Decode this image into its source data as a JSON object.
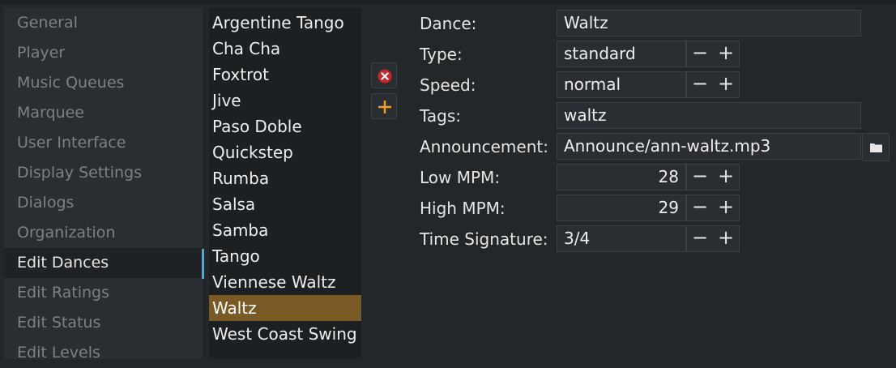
{
  "settings_nav": {
    "items": [
      {
        "label": "General"
      },
      {
        "label": "Player"
      },
      {
        "label": "Music Queues"
      },
      {
        "label": "Marquee"
      },
      {
        "label": "User Interface"
      },
      {
        "label": "Display Settings"
      },
      {
        "label": "Dialogs"
      },
      {
        "label": "Organization"
      },
      {
        "label": "Edit Dances",
        "selected": true
      },
      {
        "label": "Edit Ratings"
      },
      {
        "label": "Edit Status"
      },
      {
        "label": "Edit Levels"
      }
    ]
  },
  "dance_list": {
    "items": [
      {
        "label": "Argentine Tango"
      },
      {
        "label": "Cha Cha"
      },
      {
        "label": "Foxtrot"
      },
      {
        "label": "Jive"
      },
      {
        "label": "Paso Doble"
      },
      {
        "label": "Quickstep"
      },
      {
        "label": "Rumba"
      },
      {
        "label": "Salsa"
      },
      {
        "label": "Samba"
      },
      {
        "label": "Tango"
      },
      {
        "label": "Viennese Waltz"
      },
      {
        "label": "Waltz",
        "selected": true
      },
      {
        "label": "West Coast Swing"
      }
    ]
  },
  "actions": {
    "remove_icon": "remove-circle-icon",
    "add_icon": "plus-icon"
  },
  "form": {
    "dance": {
      "label": "Dance:",
      "value": "Waltz"
    },
    "type": {
      "label": "Type:",
      "value": "standard"
    },
    "speed": {
      "label": "Speed:",
      "value": "normal"
    },
    "tags": {
      "label": "Tags:",
      "value": "waltz"
    },
    "announcement": {
      "label": "Announcement:",
      "value": "Announce/ann-waltz.mp3",
      "browse_icon": "folder-icon"
    },
    "low_mpm": {
      "label": "Low MPM:",
      "value": "28"
    },
    "high_mpm": {
      "label": "High MPM:",
      "value": "29"
    },
    "time_signature": {
      "label": "Time Signature:",
      "value": "3/4"
    },
    "minus_glyph": "−",
    "plus_glyph": "+"
  },
  "colors": {
    "selected_item_bg": "#7a5a24",
    "accent": "#3daee9",
    "remove_red": "#c0282d",
    "add_orange": "#f0a020"
  }
}
